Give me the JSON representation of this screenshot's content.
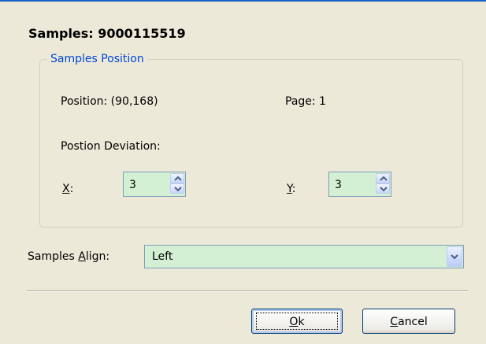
{
  "dialog": {
    "heading": "Samples: 9000115519"
  },
  "samples_position": {
    "legend": "Samples Position",
    "position_label": "Position: (90,168)",
    "page_label": "Page: 1",
    "deviation_label": "Postion Deviation:",
    "x": {
      "label": "X",
      "suffix": ":",
      "value": "3"
    },
    "y": {
      "label": "Y",
      "suffix": ":",
      "value": "3"
    }
  },
  "samples_align": {
    "label_prefix": "Samples ",
    "label_accel": "A",
    "label_rest": "lign:",
    "selected": "Left"
  },
  "buttons": {
    "ok_accel": "O",
    "ok_rest": "k",
    "cancel_accel": "C",
    "cancel_rest": "ancel"
  },
  "icons": {
    "spin_up": "chevron-up-icon",
    "spin_down": "chevron-down-icon",
    "dropdown": "chevron-down-icon"
  },
  "colors": {
    "window_bg": "#ece9d8",
    "title_accent": "#1c63c6",
    "legend_text": "#0046d5",
    "field_bg": "#d4f0d4",
    "field_border": "#7f9db9",
    "button_border": "#003c74"
  }
}
